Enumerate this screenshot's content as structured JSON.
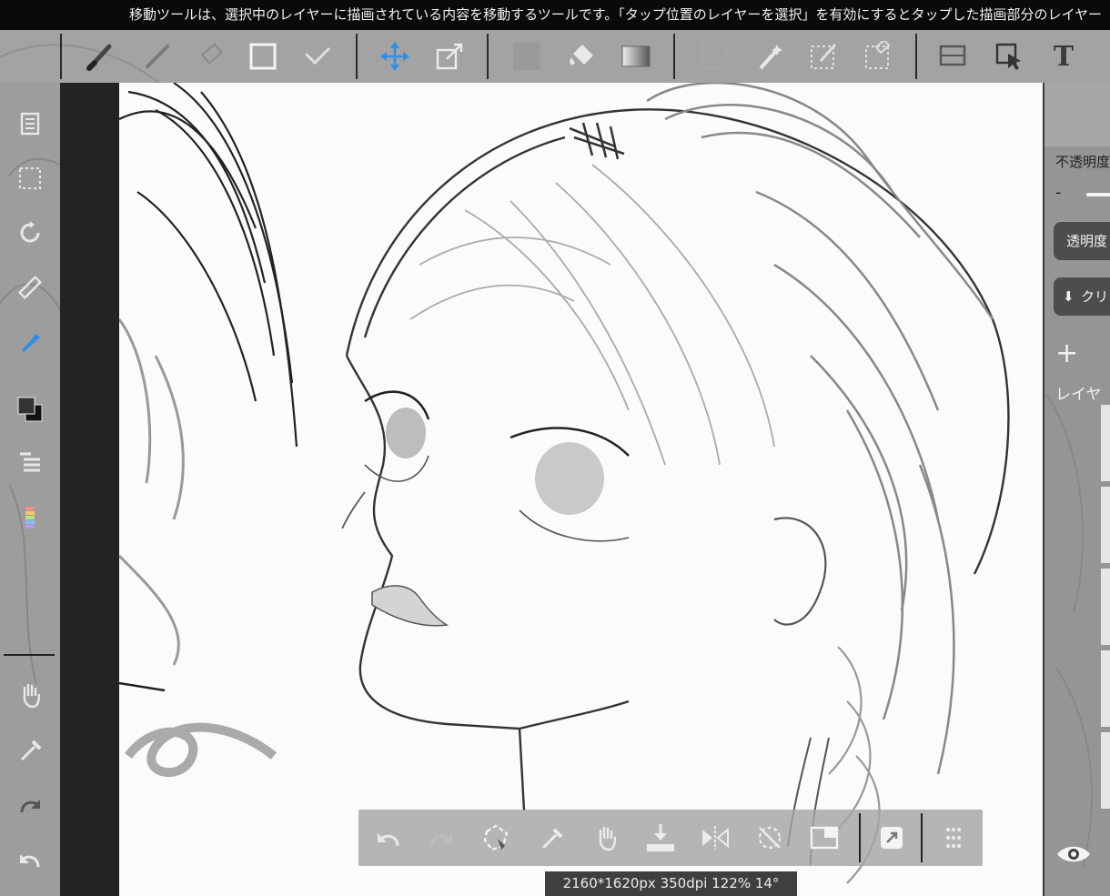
{
  "hint_text": "移動ツールは、選択中のレイヤーに描画されている内容を移動するツールです。「タップ位置のレイヤーを選択」を有効にするとタップした描画部分のレイヤー",
  "toolbar": {
    "items": [
      "brush-tool",
      "smudge-tool",
      "eraser-tool",
      "shape-tool",
      "correction-tool",
      "move-tool",
      "transform-tool",
      "fill-color",
      "bucket-tool",
      "gradient-tool",
      "select-tool",
      "magic-wand-tool",
      "select-pen-tool",
      "select-eraser-tool",
      "operation-tool",
      "select-layer-tool",
      "text-tool"
    ],
    "active": "move-tool",
    "text_tool_glyph": "T"
  },
  "left_tools": [
    "layer-icon",
    "selection-icon",
    "rotate-icon",
    "ruler-icon",
    "brush-cone-icon",
    "color-icon",
    "layer-list-icon",
    "palette-icon",
    "hand-icon",
    "eyedropper-icon",
    "redo-icon",
    "undo-icon"
  ],
  "right_panel": {
    "opacity_label": "不透明度",
    "minus_label": "-",
    "alpha_lock_label": "透明度",
    "clipping_label": "クリ",
    "add_label": "+",
    "layer_label": "レイヤ"
  },
  "float_bar": {
    "items": [
      "undo",
      "redo",
      "lasso-fill",
      "eyedropper",
      "hand",
      "download",
      "flip",
      "rotate-reset",
      "layer-view",
      "material",
      "more"
    ]
  },
  "status_text": "2160*1620px 350dpi 122% 14°",
  "colors": {
    "active_accent": "#2f8fe8",
    "hint_bg": "#0a0a0a",
    "canvas_bg": "#fbfbfb"
  }
}
